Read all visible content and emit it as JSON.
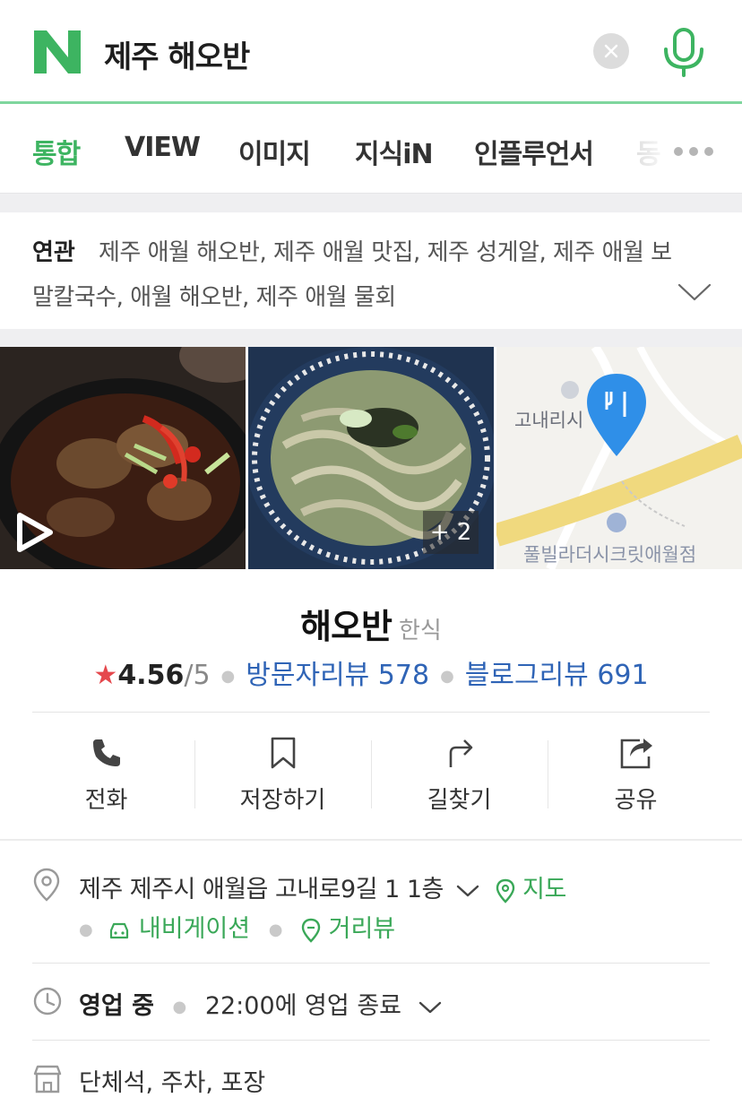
{
  "search": {
    "logo_letter": "N",
    "query": "제주 해오반",
    "brand_color": "#3db461"
  },
  "tabs": [
    {
      "label": "통합",
      "active": true
    },
    {
      "label": "VIEW",
      "active": false
    },
    {
      "label": "이미지",
      "active": false
    },
    {
      "label": "지식iN",
      "active": false
    },
    {
      "label": "인플루언서",
      "active": false
    },
    {
      "label": "동",
      "active": false
    }
  ],
  "related": {
    "label": "연관",
    "line1": "제주 애월 해오반, 제주 애월 맛집, 제주 성게알, 제주 애월 보",
    "line2": "말칼국수, 애월 해오반, 제주 애월 물회"
  },
  "photos": {
    "more_badge": "+ 2",
    "map_labels": {
      "top": "고내리시",
      "bottom": "풀빌라더시크릿애월점"
    }
  },
  "place": {
    "name": "해오반",
    "category": "한식",
    "rating": "4.56",
    "rating_max": "/5",
    "visitor_reviews": "방문자리뷰 578",
    "blog_reviews": "블로그리뷰 691"
  },
  "actions": [
    {
      "label": "전화",
      "icon": "phone-icon"
    },
    {
      "label": "저장하기",
      "icon": "bookmark-icon"
    },
    {
      "label": "길찾기",
      "icon": "directions-icon"
    },
    {
      "label": "공유",
      "icon": "share-icon"
    }
  ],
  "info": {
    "address": "제주 제주시 애월읍 고내로9길 1 1층",
    "map_link": "지도",
    "navigation_link": "내비게이션",
    "street_view_link": "거리뷰",
    "status": "영업 중",
    "hours": "22:00에 영업 종료",
    "amenities": "단체석, 주차, 포장"
  }
}
